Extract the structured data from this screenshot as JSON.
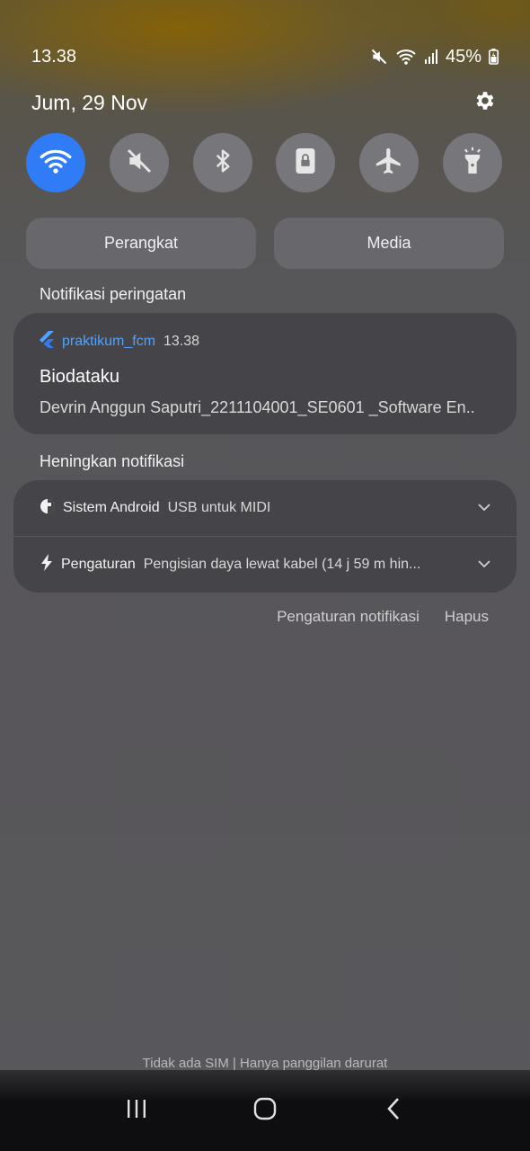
{
  "status_bar": {
    "time": "13.38",
    "battery": "45%",
    "icons": [
      "mute-icon",
      "wifi-icon",
      "signal-icon",
      "battery-icon"
    ]
  },
  "header": {
    "date": "Jum, 29 Nov",
    "settings_icon": "gear-icon"
  },
  "quick_toggles": [
    {
      "name": "wifi",
      "icon": "wifi-icon",
      "active": true
    },
    {
      "name": "sound",
      "icon": "mute-icon",
      "active": false
    },
    {
      "name": "bluetooth",
      "icon": "bluetooth-icon",
      "active": false
    },
    {
      "name": "portrait-lock",
      "icon": "lock-icon",
      "active": false
    },
    {
      "name": "airplane",
      "icon": "airplane-icon",
      "active": false
    },
    {
      "name": "flashlight",
      "icon": "flashlight-icon",
      "active": false
    }
  ],
  "output_buttons": {
    "devices": "Perangkat",
    "media": "Media"
  },
  "alert_section": {
    "label": "Notifikasi peringatan",
    "notification": {
      "app": "praktikum_fcm",
      "time": "13.38",
      "title": "Biodataku",
      "body": "Devrin Anggun Saputri_2211104001_SE0601 _Software En.."
    }
  },
  "silent_section": {
    "label": "Heningkan notifikasi",
    "items": [
      {
        "app": "Sistem Android",
        "message": "USB untuk MIDI"
      },
      {
        "app": "Pengaturan",
        "message": "Pengisian daya lewat kabel (14 j 59 m hin..."
      }
    ]
  },
  "actions": {
    "settings": "Pengaturan notifikasi",
    "clear": "Hapus"
  },
  "footer": {
    "sim_status": "Tidak ada SIM | Hanya panggilan darurat"
  },
  "colors": {
    "accent": "#2f7cf6",
    "app_name": "#4da3ff"
  }
}
